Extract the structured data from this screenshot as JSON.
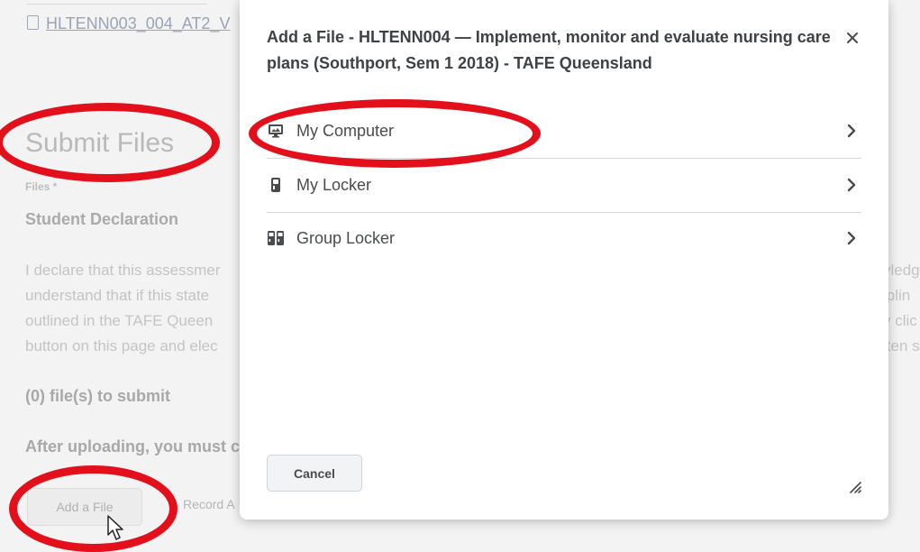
{
  "background": {
    "link_text": "HLTENN003_004_AT2_V",
    "section_title": "Submit Files",
    "files_label": "Files *",
    "declaration_heading": "Student Declaration",
    "declaration_lines": [
      {
        "left": "I declare that this assessmer",
        "right": "vledg"
      },
      {
        "left": "understand that if this state",
        "right": "iplin"
      },
      {
        "left": "outlined in the TAFE Queen",
        "right": "y clic"
      },
      {
        "left": "button on this page and elec",
        "right": "iten s"
      }
    ],
    "file_count": "(0) file(s) to submit",
    "after_uploading": "After uploading, you must c",
    "add_file_label": "Add a File",
    "record_label": "Record A"
  },
  "dialog": {
    "title": "Add a File - HLTENN004 — Implement, monitor and evaluate nursing care plans (Southport, Sem 1 2018) - TAFE Queensland",
    "options": [
      {
        "label": "My Computer",
        "icon": "monitor-icon"
      },
      {
        "label": "My Locker",
        "icon": "locker-icon"
      },
      {
        "label": "Group Locker",
        "icon": "group-locker-icon"
      }
    ],
    "cancel_label": "Cancel"
  },
  "colors": {
    "annotation_red": "#e3101c",
    "dialog_bg": "#ffffff",
    "text": "#494c4e"
  }
}
